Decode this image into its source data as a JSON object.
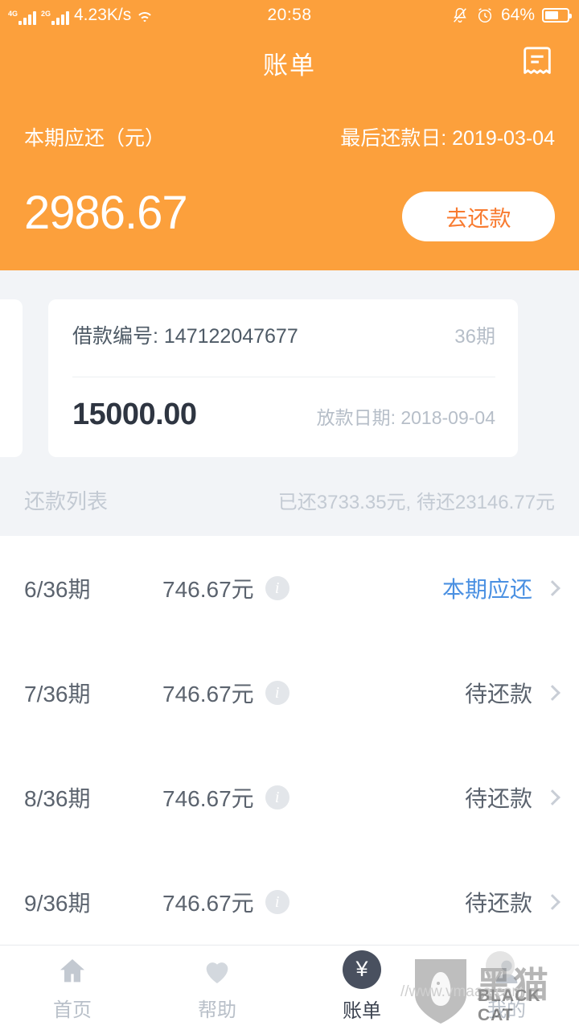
{
  "status_bar": {
    "network_4g": "4G",
    "network_2g": "2G",
    "speed": "4.23K/s",
    "time": "20:58",
    "battery_percent": "64%",
    "icons": [
      "signal-4g-icon",
      "signal-2g-icon",
      "wifi-icon",
      "mute-bell-icon",
      "alarm-clock-icon",
      "battery-icon"
    ]
  },
  "header": {
    "title": "账单",
    "bill_icon": "receipt-icon",
    "summary_label": "本期应还（元）",
    "due_date_label": "最后还款日: 2019-03-04",
    "amount": "2986.67",
    "repay_button": "去还款",
    "background_color": "#fca03c",
    "accent_color": "#f87b30"
  },
  "loan_card": {
    "loan_no_label": "借款编号: 147122047677",
    "terms": "36期",
    "principal": "15000.00",
    "disburse_date": "放款日期: 2018-09-04"
  },
  "list_header": {
    "title": "还款列表",
    "stats": "已还3733.35元, 待还23146.77元"
  },
  "repayments": [
    {
      "term": "6/36期",
      "amount": "746.67元",
      "status": "本期应还",
      "state": "current"
    },
    {
      "term": "7/36期",
      "amount": "746.67元",
      "status": "待还款",
      "state": "pending"
    },
    {
      "term": "8/36期",
      "amount": "746.67元",
      "status": "待还款",
      "state": "pending"
    },
    {
      "term": "9/36期",
      "amount": "746.67元",
      "status": "待还款",
      "state": "pending"
    }
  ],
  "bottom_nav": [
    {
      "label": "首页",
      "icon": "home-icon",
      "active": false
    },
    {
      "label": "帮助",
      "icon": "heart-icon",
      "active": false
    },
    {
      "label": "账单",
      "icon": "yen-coin-icon",
      "active": true
    },
    {
      "label": "我的",
      "icon": "person-icon",
      "active": false
    }
  ],
  "watermark": {
    "cn": "黑猫",
    "en": "BLACK CAT",
    "url": "//www.vmaaa.com",
    "logo": "cat-shield-icon"
  },
  "colors": {
    "orange": "#fca03c",
    "orange_text": "#f87b30",
    "page_gray": "#f2f4f7",
    "link_blue": "#4a90e2",
    "nav_active": "#49505f"
  }
}
